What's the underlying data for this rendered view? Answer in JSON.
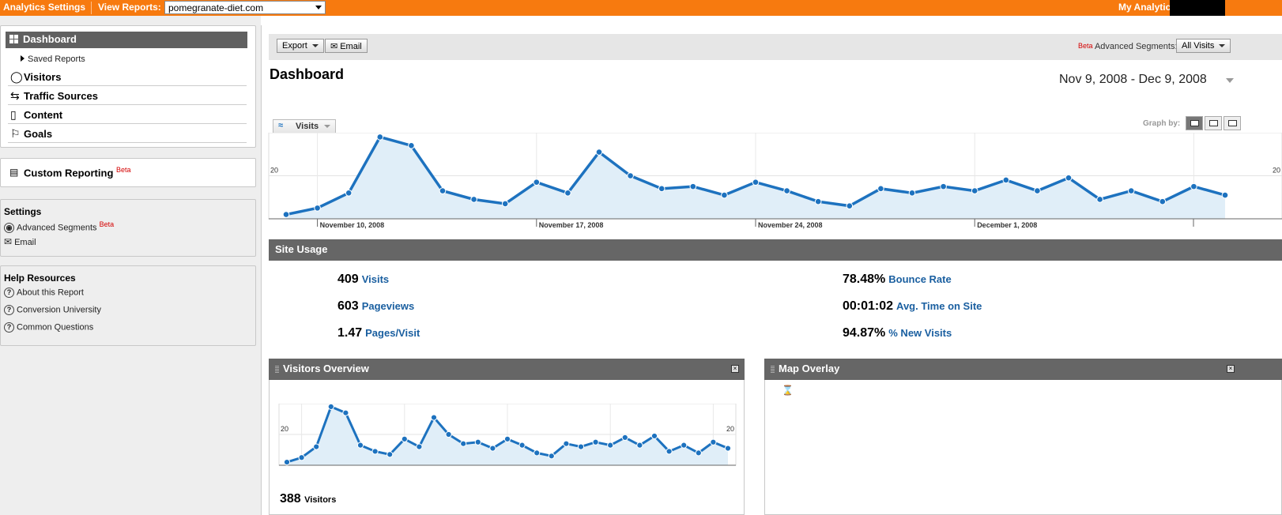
{
  "topbar": {
    "analytics_settings": "Analytics Settings",
    "view_reports_label": "View Reports:",
    "site": "pomegranate-diet.com",
    "my_analytics": "My Analytic"
  },
  "sidebar": {
    "dashboard": "Dashboard",
    "saved_reports": "Saved Reports",
    "items": [
      {
        "label": "Visitors",
        "icon": "person-icon"
      },
      {
        "label": "Traffic Sources",
        "icon": "traffic-icon"
      },
      {
        "label": "Content",
        "icon": "page-icon"
      },
      {
        "label": "Goals",
        "icon": "flag-icon"
      }
    ],
    "custom_reporting": "Custom Reporting",
    "beta": "Beta",
    "settings": {
      "heading": "Settings",
      "advanced_segments": "Advanced Segments",
      "email": "Email"
    },
    "help": {
      "heading": "Help Resources",
      "items": [
        "About this Report",
        "Conversion University",
        "Common Questions"
      ]
    }
  },
  "toolbar": {
    "export": "Export",
    "email": "Email",
    "beta": "Beta",
    "segments_label": "Advanced Segments:",
    "segments_value": "All Visits"
  },
  "page": {
    "title": "Dashboard",
    "date_range": "Nov 9, 2008 - Dec 9, 2008",
    "metric_tab": "Visits",
    "graph_by": "Graph by:"
  },
  "site_usage": {
    "title": "Site Usage",
    "stats": [
      {
        "value": "409",
        "label": "Visits"
      },
      {
        "value": "603",
        "label": "Pageviews"
      },
      {
        "value": "1.47",
        "label": "Pages/Visit"
      },
      {
        "value": "78.48%",
        "label": "Bounce Rate"
      },
      {
        "value": "00:01:02",
        "label": "Avg. Time on Site"
      },
      {
        "value": "94.87%",
        "label": "% New Visits"
      }
    ]
  },
  "visitors_overview": {
    "title": "Visitors Overview",
    "count": "388",
    "count_label": "Visitors"
  },
  "map_overlay": {
    "title": "Map Overlay"
  },
  "chart_data": [
    {
      "type": "area",
      "series": [
        {
          "values": [
            2,
            5,
            12,
            38,
            34,
            13,
            9,
            7,
            17,
            12,
            31,
            20,
            14,
            15,
            11,
            17,
            13,
            8,
            6,
            14,
            12,
            15,
            13,
            18,
            13,
            19,
            9,
            13,
            8,
            15,
            11
          ]
        }
      ],
      "ylim": [
        0,
        40
      ],
      "y_ticks": [
        "40",
        "20"
      ],
      "x_tick_labels": [
        "November 10, 2008",
        "November 17, 2008",
        "November 24, 2008",
        "December 1, 2008"
      ],
      "color": "#1d72bf",
      "fill": "#e0eef8"
    },
    {
      "type": "area",
      "series": [
        {
          "values": [
            2,
            5,
            12,
            38,
            34,
            13,
            9,
            7,
            17,
            12,
            31,
            20,
            14,
            15,
            11,
            17,
            13,
            8,
            6,
            14,
            12,
            15,
            13,
            18,
            13,
            19,
            9,
            13,
            8,
            15,
            11
          ]
        }
      ],
      "ylim": [
        0,
        40
      ],
      "y_ticks": [
        "40",
        "20"
      ],
      "color": "#1d72bf",
      "fill": "#e0eef8"
    }
  ]
}
